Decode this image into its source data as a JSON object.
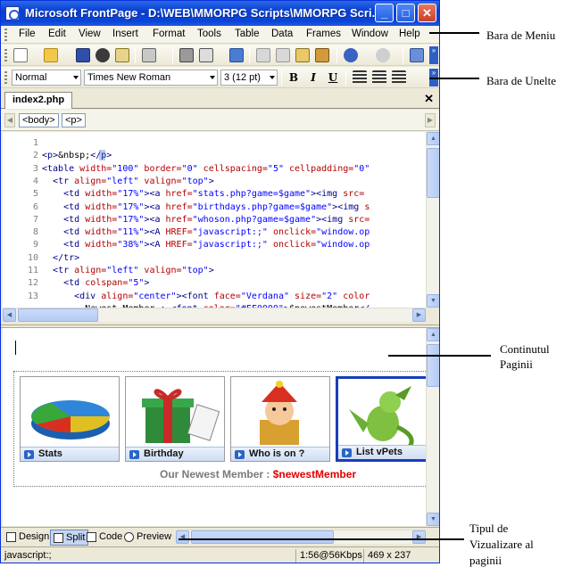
{
  "window": {
    "title": "Microsoft FrontPage - D:\\WEB\\MMORPG Scripts\\MMORPG Scri...",
    "buttons": [
      "_",
      "□",
      "✕"
    ]
  },
  "menu": [
    "File",
    "Edit",
    "View",
    "Insert",
    "Format",
    "Tools",
    "Table",
    "Data",
    "Frames",
    "Window",
    "Help"
  ],
  "format_toolbar": {
    "style": "Normal",
    "font": "Times New Roman",
    "size": "3  (12 pt)",
    "bold": "B",
    "italic": "I",
    "underline": "U"
  },
  "document_tab": "index2.php",
  "tag_selector": [
    "<body>",
    "<p>"
  ],
  "code_lines": [
    {
      "n": "1",
      "html": ""
    },
    {
      "n": "2",
      "html": "<span class='tag'>&lt;p&gt;</span><span class='txt'>&amp;nbsp;</span><span class='tag'>&lt;/p&gt;</span>"
    },
    {
      "n": "3",
      "html": "<span class='tag'>&lt;table</span> <span class='attr'>width=</span><span class='val'>\"100\"</span> <span class='attr'>border=</span><span class='val'>\"0\"</span> <span class='attr'>cellspacing=</span><span class='val'>\"5\"</span> <span class='attr'>cellpadding=</span><span class='val'>\"0\"</span>"
    },
    {
      "n": "4",
      "html": "  <span class='tag'>&lt;tr</span> <span class='attr'>align=</span><span class='val'>\"left\"</span> <span class='attr'>valign=</span><span class='val'>\"top\"</span><span class='tag'>&gt;</span>"
    },
    {
      "n": "5",
      "html": "    <span class='tag'>&lt;td</span> <span class='attr'>width=</span><span class='val'>\"17%\"</span><span class='tag'>&gt;&lt;a</span> <span class='attr'>href=</span><span class='val'>\"stats.php?game=$game\"</span><span class='tag'>&gt;&lt;img</span> <span class='attr'>src=</span>"
    },
    {
      "n": "6",
      "html": "    <span class='tag'>&lt;td</span> <span class='attr'>width=</span><span class='val'>\"17%\"</span><span class='tag'>&gt;&lt;a</span> <span class='attr'>href=</span><span class='val'>\"birthdays.php?game=$game\"</span><span class='tag'>&gt;&lt;img</span> <span class='attr'>s</span>"
    },
    {
      "n": "7",
      "html": "    <span class='tag'>&lt;td</span> <span class='attr'>width=</span><span class='val'>\"17%\"</span><span class='tag'>&gt;&lt;a</span> <span class='attr'>href=</span><span class='val'>\"whoson.php?game=$game\"</span><span class='tag'>&gt;&lt;img</span> <span class='attr'>src=</span>"
    },
    {
      "n": "8",
      "html": "    <span class='tag'>&lt;td</span> <span class='attr'>width=</span><span class='val'>\"11%\"</span><span class='tag'>&gt;&lt;A</span> <span class='attr'>HREF=</span><span class='val'>\"javascript:;\"</span> <span class='attr'>onclick=</span><span class='val'>\"window.op</span>"
    },
    {
      "n": "9",
      "html": "    <span class='tag'>&lt;td</span> <span class='attr'>width=</span><span class='val'>\"38%\"</span><span class='tag'>&gt;&lt;A</span> <span class='attr'>HREF=</span><span class='val'>\"javascript:;\"</span> <span class='attr'>onclick=</span><span class='val'>\"window.op</span>"
    },
    {
      "n": "10",
      "html": "  <span class='tag'>&lt;/tr&gt;</span>"
    },
    {
      "n": "11",
      "html": "  <span class='tag'>&lt;tr</span> <span class='attr'>align=</span><span class='val'>\"left\"</span> <span class='attr'>valign=</span><span class='val'>\"top\"</span><span class='tag'>&gt;</span>"
    },
    {
      "n": "12",
      "html": "    <span class='tag'>&lt;td</span> <span class='attr'>colspan=</span><span class='val'>\"5\"</span><span class='tag'>&gt;</span>"
    },
    {
      "n": "13",
      "html": "      <span class='tag'>&lt;div</span> <span class='attr'>align=</span><span class='val'>\"center\"</span><span class='tag'>&gt;&lt;font</span> <span class='attr'>face=</span><span class='val'>\"Verdana\"</span> <span class='attr'>size=</span><span class='val'>\"2\"</span> <span class='attr'>color</span>"
    },
    {
      "n": "",
      "html": "        <span class='txt'>Newest Member : </span><span class='tag'>&lt;font</span> <span class='attr'>color=</span><span class='val'>\"#FF0000\"</span><span class='tag'>&gt;</span><span class='txt'>$newestMember</span><span class='tag'>&lt;/</span>"
    }
  ],
  "cells": [
    {
      "label": "Stats"
    },
    {
      "label": "Birthday"
    },
    {
      "label": "Who is on ?"
    },
    {
      "label": "List vPets"
    }
  ],
  "newest": {
    "label": "Our Newest Member : ",
    "var": "$newestMember"
  },
  "views": [
    "Design",
    "Split",
    "Code",
    "Preview"
  ],
  "status": {
    "left": "javascript:;",
    "speed": "1:56@56Kbps",
    "size": "469 x 237"
  },
  "annotations": {
    "menu": "Bara de Meniu",
    "toolbar": "Bara de Unelte",
    "content": [
      "Continutul",
      "Paginii"
    ],
    "view": [
      "Tipul de",
      "Vizualizare al",
      "paginii"
    ]
  }
}
